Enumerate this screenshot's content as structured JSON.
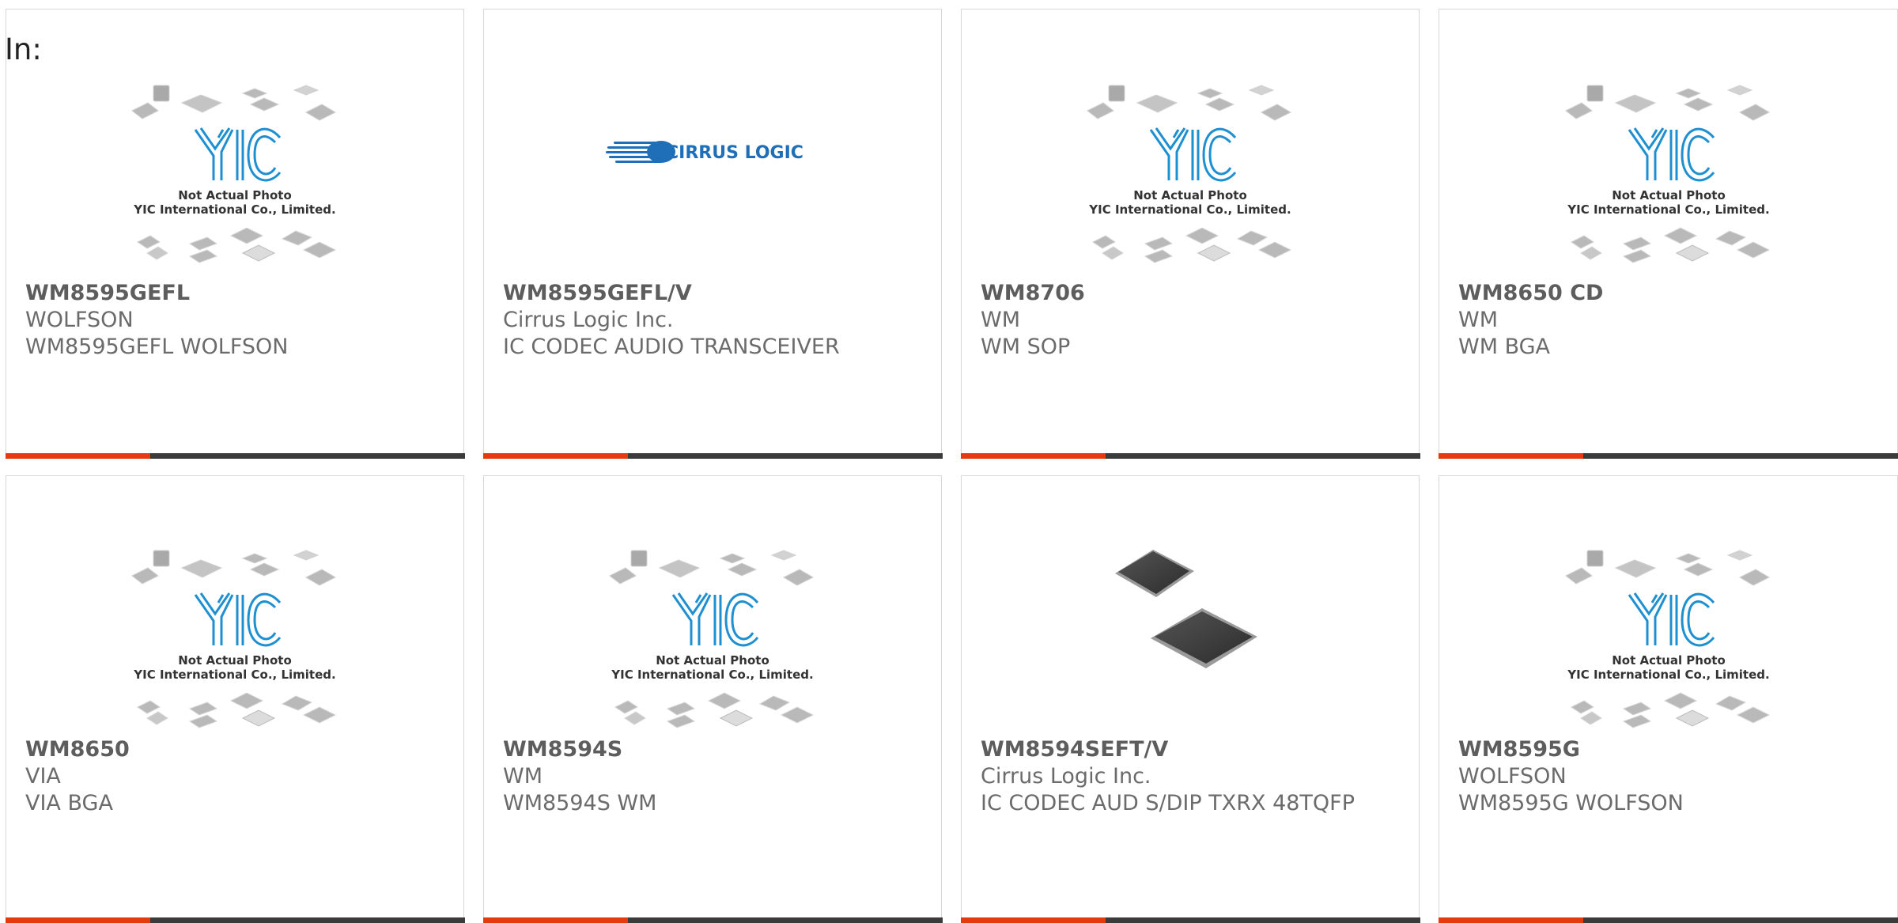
{
  "header": {
    "in_label": "In:"
  },
  "placeholder_image": {
    "caption_line1": "Not Actual Photo",
    "caption_line2": "YIC International Co., Limited."
  },
  "brand_logo": {
    "text": "CIRRUS LOGIC"
  },
  "colors": {
    "accent": "#e5390e",
    "bar": "#3b3b3b",
    "card_border": "#d6d6d6",
    "logo_blue": "#1e8fd0"
  },
  "products": [
    {
      "part_number": "WM8595GEFL",
      "manufacturer": "WOLFSON",
      "description": "WM8595GEFL WOLFSON",
      "image": "yic-placeholder-icon"
    },
    {
      "part_number": "WM8595GEFL/V",
      "manufacturer": "Cirrus Logic Inc.",
      "description": "IC CODEC AUDIO TRANSCEIVER",
      "image": "cirrus-logic-logo"
    },
    {
      "part_number": "WM8706",
      "manufacturer": "WM",
      "description": "WM SOP",
      "image": "yic-placeholder-icon"
    },
    {
      "part_number": "WM8650 CD",
      "manufacturer": "WM",
      "description": "WM BGA",
      "image": "yic-placeholder-icon"
    },
    {
      "part_number": "WM8650",
      "manufacturer": "VIA",
      "description": "VIA BGA",
      "image": "yic-placeholder-icon"
    },
    {
      "part_number": "WM8594S",
      "manufacturer": "WM",
      "description": "WM8594S WM",
      "image": "yic-placeholder-icon"
    },
    {
      "part_number": "WM8594SEFT/V",
      "manufacturer": "Cirrus Logic Inc.",
      "description": "IC CODEC AUD S/DIP TXRX 48TQFP",
      "image": "tqfp-chip-photo"
    },
    {
      "part_number": "WM8595G",
      "manufacturer": "WOLFSON",
      "description": "WM8595G WOLFSON",
      "image": "yic-placeholder-icon"
    }
  ]
}
